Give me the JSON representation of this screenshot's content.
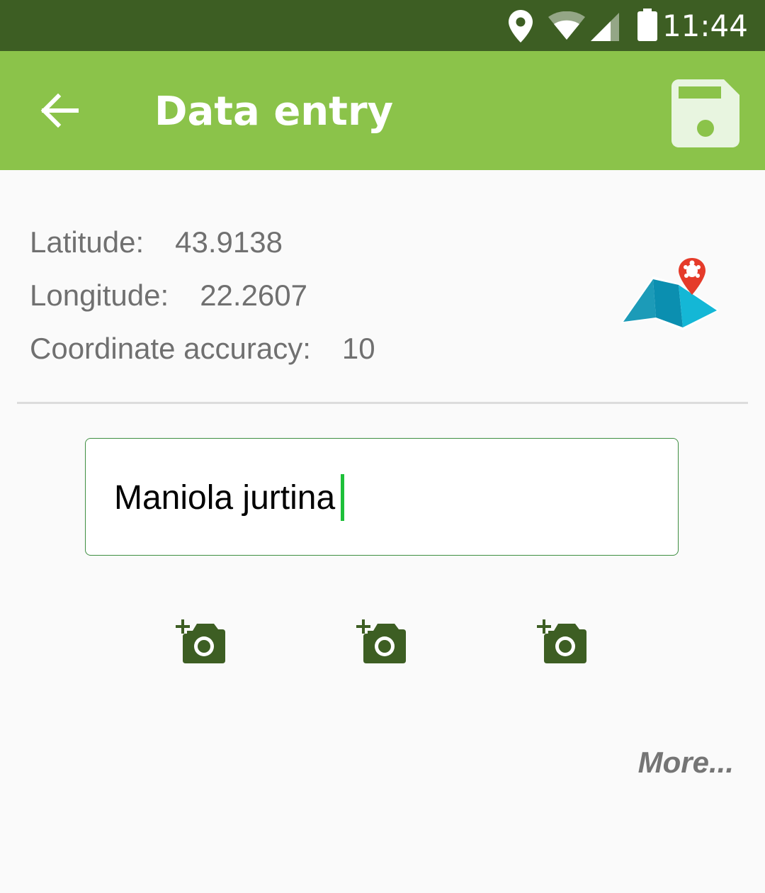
{
  "status_bar": {
    "time": "11:44",
    "icons": [
      "location-icon",
      "wifi-icon",
      "cell-signal-icon",
      "battery-icon"
    ]
  },
  "app_bar": {
    "title": "Data entry",
    "back_icon": "arrow-left-icon",
    "save_icon": "floppy-disk-icon",
    "color": "#8bc34a",
    "status_color": "#3d5e23"
  },
  "coordinates": {
    "latitude_label": "Latitude:",
    "latitude_value": "43.9138",
    "longitude_label": "Longitude:",
    "longitude_value": "22.2607",
    "accuracy_label": "Coordinate accuracy:",
    "accuracy_value": "10",
    "map_icon": "map-pin-turtle-icon"
  },
  "species": {
    "value": "Maniola jurtina"
  },
  "photos": {
    "icons": [
      "add-photo-icon",
      "add-photo-icon",
      "add-photo-icon"
    ],
    "icon_color": "#3d5e23"
  },
  "more_label": "More..."
}
